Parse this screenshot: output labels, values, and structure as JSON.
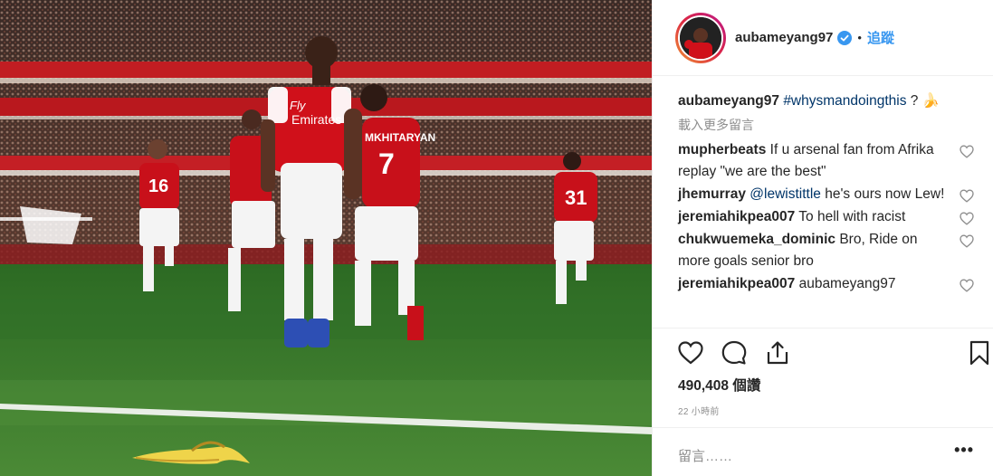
{
  "post": {
    "photo_alt": "football players on pitch with banana peel",
    "username": "aubameyang97",
    "verified": true,
    "separator": "•",
    "follow_label": "追蹤",
    "caption": {
      "username": "aubameyang97",
      "hashtag": "#whysmandoingthis",
      "text": " ?",
      "emoji": "🍌"
    },
    "load_more_label": "載入更多留言",
    "comments": [
      {
        "username": "mupherbeats",
        "mention": "",
        "text": "If u arsenal fan from Afrika replay \"we are the best\""
      },
      {
        "username": "jhemurray",
        "mention": "@lewistittle",
        "text": " he's ours now Lew!"
      },
      {
        "username": "jeremiahikpea007",
        "mention": "",
        "text": "To hell with racist"
      },
      {
        "username": "chukwuemeka_dominic",
        "mention": "",
        "text": "Bro, Ride on more goals senior bro"
      },
      {
        "username": "jeremiahikpea007",
        "mention": "",
        "text": "aubameyang97"
      }
    ],
    "actions": {
      "like_icon": "heart-outline-icon",
      "comment_icon": "speech-bubble-icon",
      "share_icon": "share-upload-icon",
      "save_icon": "bookmark-icon"
    },
    "likes_label": "490,408 個讚",
    "timestamp": "22 小時前",
    "add_comment_placeholder": "留言……",
    "more_options": "•••"
  },
  "colors": {
    "link": "#3897f0",
    "hashtag": "#003569",
    "muted": "#8e8e8e",
    "text": "#262626",
    "arsenal_red": "#d0101a",
    "pitch_green": "#3b7a2a"
  }
}
